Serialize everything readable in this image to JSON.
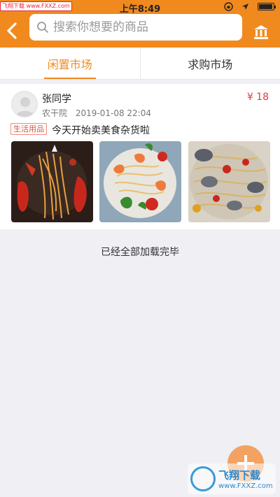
{
  "status_bar": {
    "source_badge": "飞翔下载 www.FXXZ.com",
    "time": "上午8:49"
  },
  "header": {
    "search_placeholder": "搜索你想要的商品",
    "back_icon": "chevron-left-icon",
    "right_icon": "bank-icon"
  },
  "tabs": [
    {
      "label": "闲置市场",
      "active": true
    },
    {
      "label": "求购市场",
      "active": false
    }
  ],
  "listing": {
    "seller": "张同学",
    "price": "¥ 18",
    "location": "农干院",
    "datetime": "2019-01-08 22:04",
    "tag": "生活用品",
    "description": "今天开始卖美食杂货啦",
    "photos": [
      "lobster-pasta",
      "shrimp-pasta",
      "clam-pasta"
    ]
  },
  "list_footer": "已经全部加载完毕",
  "watermark": {
    "name": "飞翔下载",
    "url": "www.FXXZ.com"
  },
  "colors": {
    "accent": "#f08a1e",
    "price": "#e23c3c"
  }
}
